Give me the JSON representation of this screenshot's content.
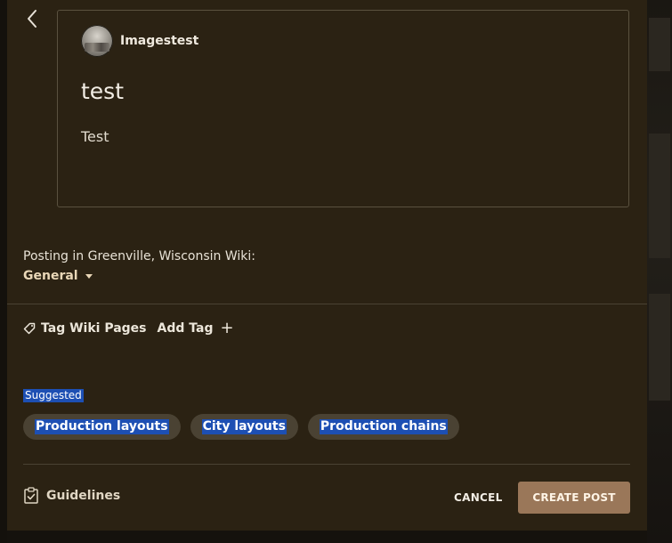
{
  "preview": {
    "author_name": "Imagestest",
    "title": "test",
    "body": "Test"
  },
  "posting": {
    "label": "Posting in Greenville, Wisconsin Wiki:",
    "category": "General"
  },
  "tags": {
    "label": "Tag Wiki Pages",
    "add_label": "Add Tag",
    "suggested_label": "Suggested",
    "suggested": [
      "Production layouts",
      "City layouts",
      "Production chains"
    ]
  },
  "footer": {
    "guidelines_label": "Guidelines",
    "cancel_label": "CANCEL",
    "create_label": "CREATE POST"
  },
  "colors": {
    "panel_bg": "#2b2213",
    "accent_button": "#9a7759",
    "selection_highlight": "#1d4fb3",
    "chip_bg": "#4a4233"
  },
  "icons": {
    "back": "chevron-left-icon",
    "caret": "caret-down-icon",
    "tag": "tag-icon",
    "add": "plus-icon",
    "guidelines": "clipboard-check-icon"
  }
}
